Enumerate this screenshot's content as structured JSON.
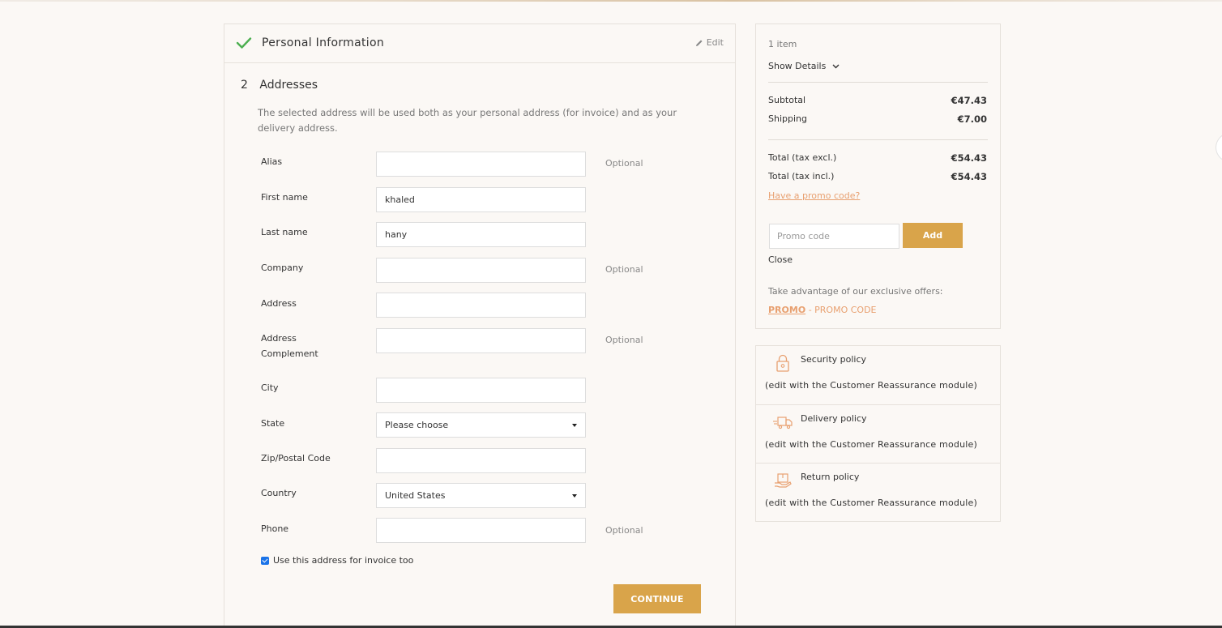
{
  "personal": {
    "title": "Personal Information",
    "edit_label": "Edit"
  },
  "addresses": {
    "step_number": "2",
    "title": "Addresses",
    "description": "The selected address will be used both as your personal address (for invoice) and as your delivery address.",
    "optional_text": "Optional",
    "fields": {
      "alias": {
        "label": "Alias",
        "value": ""
      },
      "first_name": {
        "label": "First name",
        "value": "khaled"
      },
      "last_name": {
        "label": "Last name",
        "value": "hany"
      },
      "company": {
        "label": "Company",
        "value": ""
      },
      "address": {
        "label": "Address",
        "value": ""
      },
      "address_complement": {
        "label": "Address Complement",
        "value": ""
      },
      "city": {
        "label": "City",
        "value": ""
      },
      "state": {
        "label": "State",
        "value": "Please choose"
      },
      "zip": {
        "label": "Zip/Postal Code",
        "value": ""
      },
      "country": {
        "label": "Country",
        "value": "United States"
      },
      "phone": {
        "label": "Phone",
        "value": ""
      }
    },
    "invoice_checkbox_label": "Use this address for invoice too",
    "invoice_checked": true,
    "continue_label": "CONTINUE"
  },
  "cart": {
    "item_count": "1 item",
    "show_details": "Show Details",
    "subtotal_label": "Subtotal",
    "subtotal_value": "€47.43",
    "shipping_label": "Shipping",
    "shipping_value": "€7.00",
    "total_excl_label": "Total (tax excl.)",
    "total_excl_value": "€54.43",
    "total_incl_label": "Total (tax incl.)",
    "total_incl_value": "€54.43",
    "promo_link": "Have a promo code?",
    "promo_placeholder": "Promo code",
    "add_label": "Add",
    "close_label": "Close",
    "offers_text": "Take advantage of our exclusive offers:",
    "offer_code": "PROMO",
    "offer_name": "- PROMO CODE"
  },
  "reassurance": [
    {
      "title": "Security policy",
      "subtitle": "(edit with the Customer Reassurance module)",
      "icon": "lock-icon"
    },
    {
      "title": "Delivery policy",
      "subtitle": "(edit with the Customer Reassurance module)",
      "icon": "delivery-truck-icon"
    },
    {
      "title": "Return policy",
      "subtitle": "(edit with the Customer Reassurance module)",
      "icon": "return-package-icon"
    }
  ],
  "colors": {
    "accent": "#d9a44a",
    "link": "#e8a070",
    "check": "#4caf50",
    "background": "#fbf8f5"
  }
}
